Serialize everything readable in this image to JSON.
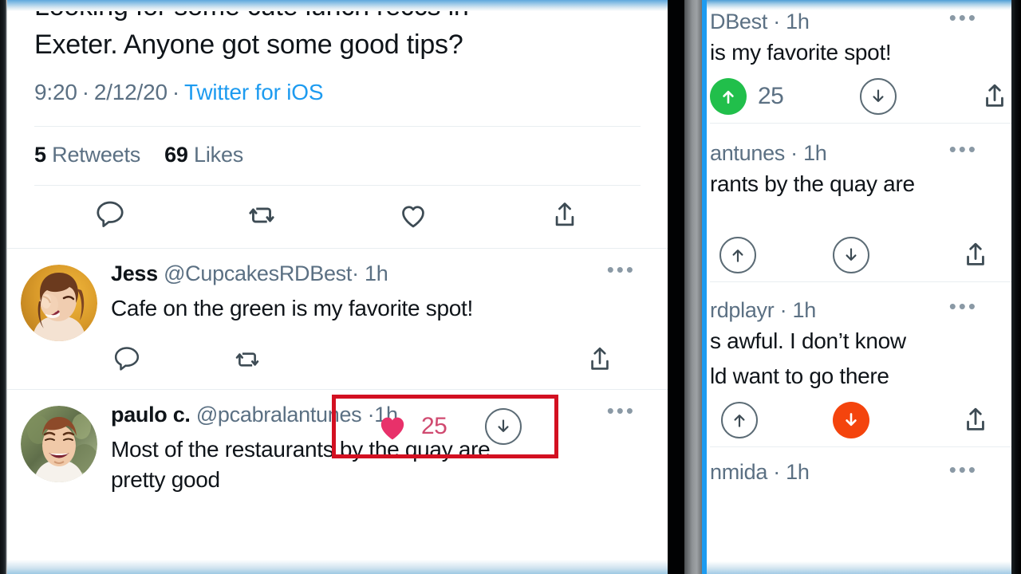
{
  "left_panel": {
    "tweet": {
      "text_line1": "Looking for some cute lunch reccs in",
      "text_line2": "Exeter. Anyone got some good tips?",
      "time": "9:20",
      "dot1": "·",
      "date": "2/12/20",
      "dot2": "·",
      "source": "Twitter for iOS",
      "retweet_count": "5",
      "retweet_label": "Retweets",
      "like_count": "69",
      "like_label": "Likes",
      "actions": [
        "reply-icon",
        "retweet-icon",
        "like-icon",
        "share-icon"
      ]
    },
    "replies": [
      {
        "name": "Jess",
        "handle": "@CupcakesRDBest",
        "separator": "·",
        "time": "1h",
        "text": "Cafe on the green is my favorite spot!",
        "like_count": "25",
        "overflow": "•••",
        "avatar_alt": "woman-laughing-avatar",
        "highlighted": true
      },
      {
        "name": "paulo c.",
        "handle": "@pcabralantunes",
        "separator": "·",
        "time": "1h",
        "text_line1": "Most of the restaurants by the quay are",
        "text_line2": "pretty good",
        "overflow": "•••",
        "avatar_alt": "man-smiling-avatar",
        "highlighted": false
      }
    ]
  },
  "right_panel": {
    "items": [
      {
        "header": "DBest · 1h",
        "text": "is my favorite spot!",
        "upvote_state": "active-green",
        "downvote_state": "inactive",
        "count": "25",
        "overflow": "•••"
      },
      {
        "header": "antunes · 1h",
        "text": "rants by the quay are",
        "upvote_state": "inactive",
        "downvote_state": "inactive",
        "count": "",
        "overflow": "•••"
      },
      {
        "header": "rdplayr · 1h",
        "text_line1": "s awful. I don’t know",
        "text_line2": "ld want to go there",
        "upvote_state": "inactive",
        "downvote_state": "active-orange",
        "count": "",
        "overflow": "•••"
      },
      {
        "header": "nmida · 1h",
        "overflow": "•••"
      }
    ]
  },
  "colors": {
    "twitter_blue": "#1d9bf0",
    "like_pink": "#e8316a",
    "like_count_pink": "#d04a70",
    "highlight_red": "#d31021",
    "upvote_green": "#21bf4b",
    "downvote_orange": "#f4440d",
    "text_dark": "#0f1419",
    "text_muted": "#5b7083"
  }
}
